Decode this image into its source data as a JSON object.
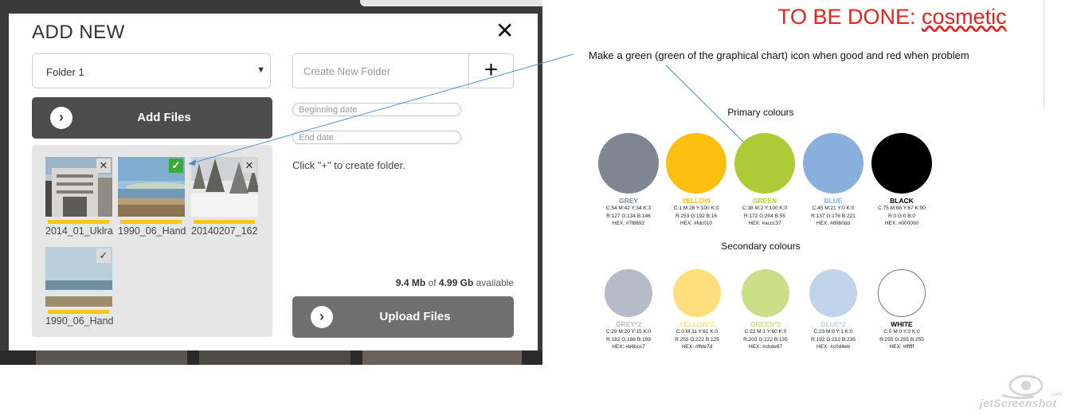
{
  "modal": {
    "title": "ADD NEW",
    "close_glyph": "✕",
    "folder_select": {
      "value": "Folder 1",
      "arrow": "▼"
    },
    "new_folder": {
      "placeholder": "Create New Folder",
      "plus": "+"
    },
    "beginning_date_placeholder": "Beginning date",
    "end_date_placeholder": "End date",
    "hint": "Click \"+\" to create folder.",
    "add_files_label": "Add Files",
    "upload_files_label": "Upload Files",
    "button_icon": "chevron-right-icon",
    "storage": {
      "used": "9.4 Mb",
      "of": "of",
      "total": "4.99 Gb",
      "suffix": "available"
    },
    "files": [
      {
        "name": "2014_01_Uklra",
        "mark": "✕",
        "status": "remove"
      },
      {
        "name": "1990_06_Hand",
        "mark": "✓",
        "status": "selected"
      },
      {
        "name": "20140207_162",
        "mark": "✕",
        "status": "remove"
      },
      {
        "name": "1990_06_Hand",
        "mark": "✓",
        "status": "done"
      }
    ]
  },
  "annotation": {
    "todo_prefix": "TO BE DONE: ",
    "todo_word": "cosmetic",
    "note": "Make a green (green of the graphical chart)  icon when good and red when problem"
  },
  "palette": {
    "primary_heading": "Primary colours",
    "secondary_heading": "Secondary colours",
    "primary": [
      {
        "name": "GREY",
        "color": "#7f8692",
        "cmyk": "C:54 M:42 Y:34 K:3",
        "rgb": "R:127 G:134 B:146",
        "hex": "HEX: #7f8692"
      },
      {
        "name": "YELLOW",
        "color": "#fdc010",
        "cmyk": "C:1 M:26 Y:100 K:0",
        "rgb": "R:253 G:192 B:16",
        "hex": "HEX: #fdc010"
      },
      {
        "name": "GREEN",
        "color": "#accc37",
        "cmyk": "C:38 M:2 Y:100 K:0",
        "rgb": "R:172 G:204 B:55",
        "hex": "HEX: #accc37"
      },
      {
        "name": "BLUE",
        "color": "#89b0dd",
        "cmyk": "C:45 M:21 Y:0 K:0",
        "rgb": "R:137 G:176 B:221",
        "hex": "HEX: #89b0dd"
      },
      {
        "name": "BLACK",
        "color": "#000000",
        "cmyk": "C:75 M:68 Y:67 K:90",
        "rgb": "R:0 G:0 B:0",
        "hex": "HEX: #000000"
      }
    ],
    "secondary": [
      {
        "name": "GREY*2",
        "color": "#b6bcc7",
        "cmyk": "C:29 M:20 Y:15 K:0",
        "rgb": "R:182 G:188 B:199",
        "hex": "HEX: #b6bcc7"
      },
      {
        "name": "YELLOW*2",
        "color": "#ffde7d",
        "cmyk": "C:0 M:11 Y:61 K:0",
        "rgb": "R:255 G:222 B:125",
        "hex": "HEX: #ffde7d"
      },
      {
        "name": "GREEN*2",
        "color": "#cbde87",
        "cmyk": "C:22 M:1 Y:60 K:0",
        "rgb": "R:203 G:222 B:135",
        "hex": "HEX: #cbde87"
      },
      {
        "name": "BLUE*2",
        "color": "#c0d4eb",
        "cmyk": "C:23 M:9 Y:1 K:0",
        "rgb": "R:192 G:212 B:235",
        "hex": "HEX: #c0d4eb"
      },
      {
        "name": "WHITE",
        "color": "#ffffff",
        "cmyk": "C:0 M:0 Y:0 K:0",
        "rgb": "R:255 G:255 B:255",
        "hex": "HEX: #ffffff"
      }
    ]
  },
  "watermark": {
    "text": "jetScreenshot",
    "tld": ".com"
  }
}
